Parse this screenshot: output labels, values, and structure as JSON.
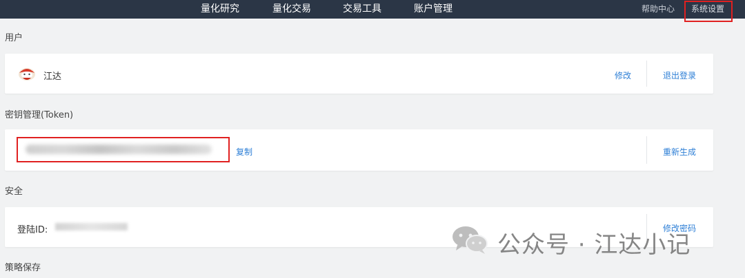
{
  "nav": {
    "items": [
      "量化研究",
      "量化交易",
      "交易工具",
      "账户管理"
    ],
    "help": "帮助中心",
    "settings": "系统设置"
  },
  "user": {
    "section_title": "用户",
    "name": "江达",
    "edit_label": "修改",
    "logout_label": "退出登录"
  },
  "token": {
    "section_title": "密钥管理(Token)",
    "copy_label": "复制",
    "regenerate_label": "重新生成"
  },
  "security": {
    "section_title": "安全",
    "login_id_label": "登陆ID:",
    "change_password_label": "修改密码"
  },
  "strategy": {
    "section_title": "策略保存"
  },
  "watermark": {
    "text": "公众号 · 江达小记",
    "icon": "wechat-icon"
  },
  "colors": {
    "topbar": "#2b3646",
    "link": "#2e7fd6",
    "highlight": "#e02020"
  }
}
